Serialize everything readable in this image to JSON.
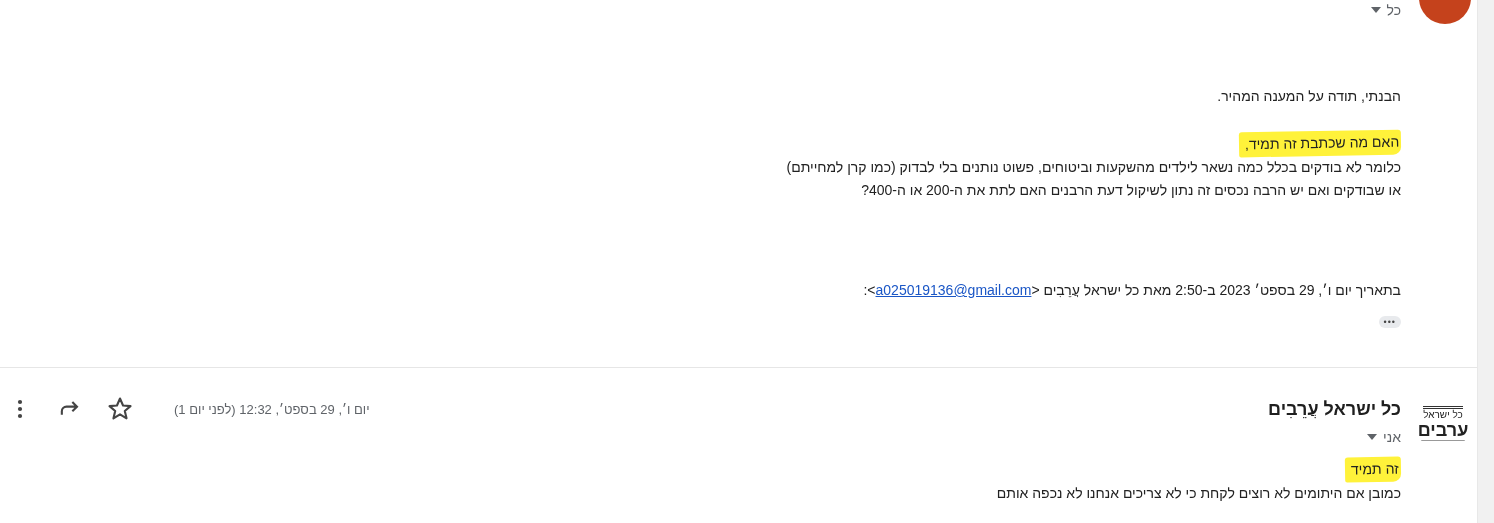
{
  "messages": [
    {
      "avatar": {
        "kind": "letter",
        "color": "#c5421c"
      },
      "recipient": "כל",
      "body": [
        {
          "lines": [
            {
              "text": "הבנתי, תודה על המענה המהיר.",
              "highlighted": false
            }
          ]
        },
        {
          "lines": [
            {
              "text": "האם מה שכתבת זה תמיד,",
              "highlighted": true
            },
            {
              "text": "כלומר לא בודקים בכלל כמה נשאר לילדים מהשקעות וביטוחים, פשוט נותנים בלי לבדוק (כמו קרן למחייתם)",
              "highlighted": false
            },
            {
              "text": "או שבודקים ואם יש הרבה נכסים זה נתון לשיקול דעת הרבנים האם לתת את ה-200 או ה-400?",
              "highlighted": false
            }
          ]
        }
      ],
      "quote_header": {
        "before": "בתאריך יום ו׳, 29 בספט׳ 2023 ב-2:50 מאת כל ישראל עֲרֵבִים <",
        "email": "a025019136@gmail.com",
        "after": ">:"
      },
      "show_trimmed": "•••"
    },
    {
      "avatar": {
        "kind": "logo",
        "lines": [
          "כל ישראל",
          "ערבים"
        ]
      },
      "sender": "כל ישראל עֲרֵבִים",
      "recipient": "אני",
      "date": "יום ו׳, 29 בספט׳, 12:32 (לפני יום 1)",
      "starred": false,
      "body": [
        {
          "lines": [
            {
              "text": "זה תמיד",
              "highlighted": true
            },
            {
              "text": "כמובן אם היתומים לא רוצים לקחת כי לא צריכים אנחנו לא נכפה אותם",
              "highlighted": false
            }
          ]
        }
      ]
    }
  ]
}
